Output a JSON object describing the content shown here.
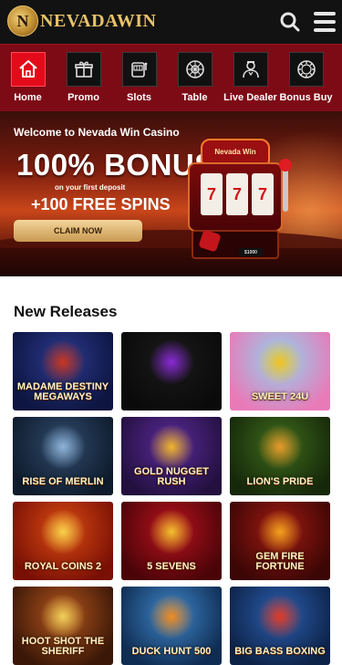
{
  "header": {
    "logo_text": "NEVADAWIN",
    "logo_letter": "N",
    "search_icon": "search-icon",
    "menu_icon": "hamburger-menu-icon"
  },
  "categories": [
    {
      "label": "Home",
      "icon": "home-icon",
      "active": true
    },
    {
      "label": "Promo",
      "icon": "gift-icon",
      "active": false
    },
    {
      "label": "Slots",
      "icon": "slot-machine-icon",
      "active": false
    },
    {
      "label": "Table",
      "icon": "roulette-icon",
      "active": false
    },
    {
      "label": "Live Dealer",
      "icon": "dealer-icon",
      "active": false
    },
    {
      "label": "Bonus Buy",
      "icon": "chip-icon",
      "active": false
    }
  ],
  "banner": {
    "welcome": "Welcome to Nevada Win Casino",
    "headline": "100% BONUS",
    "subline": "on your first deposit",
    "spins": "+100 FREE SPINS",
    "cta": "CLAIM NOW",
    "slot_sign": "Nevada Win",
    "slot_badge": "$1000",
    "reels": [
      "7",
      "7",
      "7"
    ],
    "slides_total": 10,
    "active_slide": 1
  },
  "releases": {
    "title": "New Releases",
    "games": [
      {
        "name": "Madame Destiny Megaways",
        "bg1": "#2b3a8f",
        "bg2": "#0d1540",
        "accent": "#c9351f"
      },
      {
        "name": "",
        "bg1": "#1a1a1a",
        "bg2": "#0a0a0a",
        "accent": "#8a2ad6"
      },
      {
        "name": "Sweet 24U",
        "bg1": "#8ed3f0",
        "bg2": "#e97ab8",
        "accent": "#f5c21c"
      },
      {
        "name": "Rise of Merlin",
        "bg1": "#2f4a6b",
        "bg2": "#0e1b2c",
        "accent": "#8fb4d9"
      },
      {
        "name": "Gold Nugget Rush",
        "bg1": "#5a2a9a",
        "bg2": "#23103f",
        "accent": "#f0b62a"
      },
      {
        "name": "Lion's Pride",
        "bg1": "#3d6b1c",
        "bg2": "#16280a",
        "accent": "#e89a2a"
      },
      {
        "name": "Royal Coins 2",
        "bg1": "#d94a12",
        "bg2": "#7a1005",
        "accent": "#f7d24a"
      },
      {
        "name": "5 Sevens",
        "bg1": "#b8121e",
        "bg2": "#4a0408",
        "accent": "#f2c12e"
      },
      {
        "name": "Gem Fire Fortune",
        "bg1": "#a11a12",
        "bg2": "#3b0605",
        "accent": "#f2a31e"
      },
      {
        "name": "Hoot Shot the Sheriff",
        "bg1": "#b3541c",
        "bg2": "#3a1707",
        "accent": "#f0d05a"
      },
      {
        "name": "Duck Hunt 500",
        "bg1": "#3e86c9",
        "bg2": "#0f2c52",
        "accent": "#f08a1e"
      },
      {
        "name": "Big Bass Boxing",
        "bg1": "#2b5fb0",
        "bg2": "#0d2247",
        "accent": "#e23a22"
      }
    ]
  }
}
